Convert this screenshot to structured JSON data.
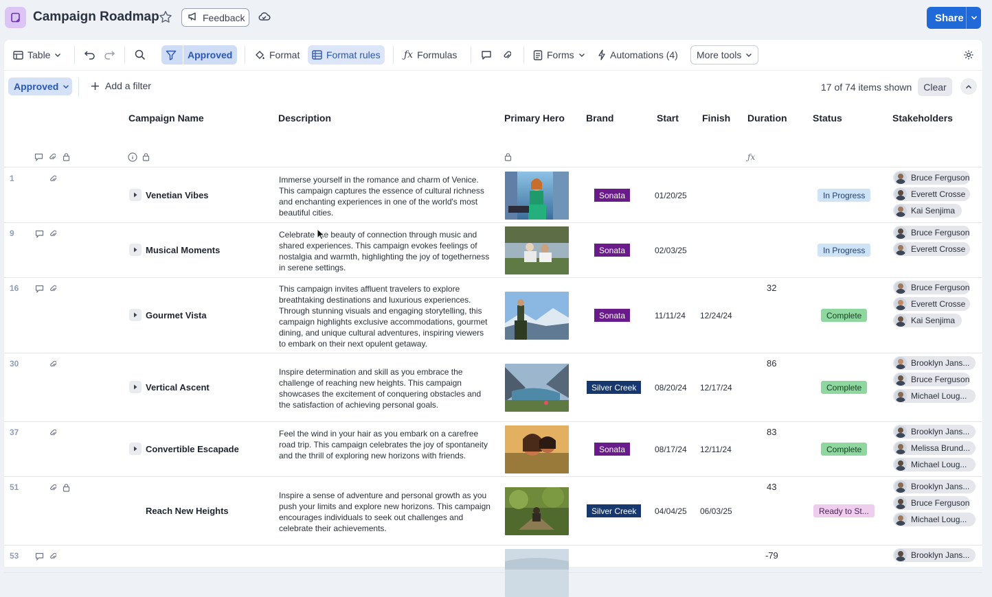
{
  "app": {
    "title": "Campaign Roadmap",
    "feedback_label": "Feedback",
    "share_label": "Share"
  },
  "toolbar": {
    "view_label": "Table",
    "filter_label": "Approved",
    "format_label": "Format",
    "format_rules_label": "Format rules",
    "formulas_label": "Formulas",
    "forms_label": "Forms",
    "automations_label": "Automations (4)",
    "more_tools_label": "More tools"
  },
  "filterbar": {
    "active_filter": "Approved",
    "add_filter_label": "Add a filter",
    "items_shown": "17 of 74 items shown",
    "clear_label": "Clear"
  },
  "columns": {
    "campaign_name": "Campaign Name",
    "description": "Description",
    "primary_hero": "Primary Hero",
    "brand": "Brand",
    "start": "Start",
    "finish": "Finish",
    "duration": "Duration",
    "status": "Status",
    "stakeholders": "Stakeholders"
  },
  "colors": {
    "sonata": "#6a1b8a",
    "silver_creek": "#17386e",
    "accent": "#1f6ad8"
  },
  "rows": [
    {
      "num": "1",
      "name": "Venetian Vibes",
      "description": "Immerse yourself in the romance and charm of Venice. This campaign captures the essence of cultural richness and enchanting experiences in one of the world's most beautiful cities.",
      "brand": "Sonata",
      "start": "01/20/25",
      "finish": "",
      "duration": "",
      "status": "In Progress",
      "stakeholders": [
        "Bruce Ferguson",
        "Everett Crosse",
        "Kai Senjima"
      ]
    },
    {
      "num": "9",
      "name": "Musical Moments",
      "description": "Celebrate the beauty of connection through music and shared experiences. This campaign evokes feelings of nostalgia and warmth, highlighting the joy of togetherness in serene settings.",
      "brand": "Sonata",
      "start": "02/03/25",
      "finish": "",
      "duration": "",
      "status": "In Progress",
      "stakeholders": [
        "Bruce Ferguson",
        "Everett Crosse"
      ]
    },
    {
      "num": "16",
      "name": "Gourmet Vista",
      "description": "This campaign invites affluent travelers to explore breathtaking destinations and luxurious experiences. Through stunning visuals and engaging storytelling, this campaign highlights exclusive accommodations, gourmet dining, and unique cultural adventures, inspiring viewers to embark on their next opulent getaway.",
      "brand": "Sonata",
      "start": "11/11/24",
      "finish": "12/24/24",
      "duration": "32",
      "status": "Complete",
      "stakeholders": [
        "Bruce Ferguson",
        "Everett Crosse",
        "Kai Senjima"
      ]
    },
    {
      "num": "30",
      "name": "Vertical Ascent",
      "description": "Inspire determination and skill as you embrace the challenge of reaching new heights. This campaign showcases the excitement of conquering obstacles and the satisfaction of achieving personal goals.",
      "brand": "Silver Creek",
      "start": "08/20/24",
      "finish": "12/17/24",
      "duration": "86",
      "status": "Complete",
      "stakeholders": [
        "Brooklyn Jans...",
        "Bruce Ferguson",
        "Michael Loug..."
      ]
    },
    {
      "num": "37",
      "name": "Convertible Escapade",
      "description": "Feel the wind in your hair as you embark on a carefree road trip. This campaign celebrates the joy of spontaneity and the thrill of exploring new horizons with friends.",
      "brand": "Sonata",
      "start": "08/17/24",
      "finish": "12/11/24",
      "duration": "83",
      "status": "Complete",
      "stakeholders": [
        "Brooklyn Jans...",
        "Melissa Brund...",
        "Michael Loug..."
      ]
    },
    {
      "num": "51",
      "name": "Reach New Heights",
      "description": "Inspire a sense of adventure and personal growth as you push your limits and explore new horizons. This campaign encourages individuals to seek out challenges and celebrate their achievements.",
      "brand": "Silver Creek",
      "start": "04/04/25",
      "finish": "06/03/25",
      "duration": "43",
      "status": "Ready to St...",
      "stakeholders": [
        "Brooklyn Jans...",
        "Bruce Ferguson",
        "Michael Loug..."
      ]
    },
    {
      "num": "53",
      "name": "",
      "description": "",
      "brand": "",
      "start": "",
      "finish": "",
      "duration": "-79",
      "status": "",
      "stakeholders": [
        "Brooklyn Jans..."
      ]
    }
  ]
}
